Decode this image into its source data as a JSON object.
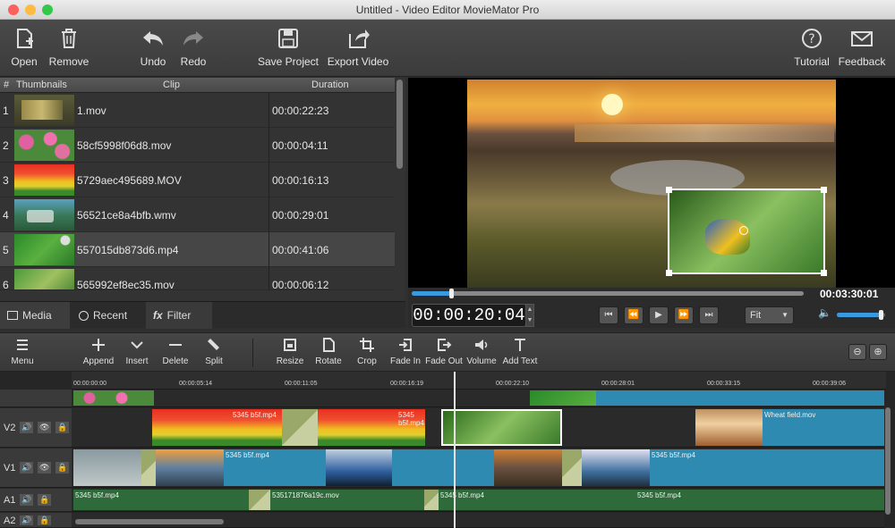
{
  "window": {
    "title": "Untitled - Video Editor MovieMator Pro"
  },
  "toolbar": {
    "open": "Open",
    "remove": "Remove",
    "undo": "Undo",
    "redo": "Redo",
    "save_project": "Save Project",
    "export_video": "Export Video",
    "tutorial": "Tutorial",
    "feedback": "Feedback"
  },
  "media_table": {
    "headers": {
      "num": "#",
      "thumbnails": "Thumbnails",
      "clip": "Clip",
      "duration": "Duration"
    },
    "rows": [
      {
        "num": "1",
        "clip": "1.mov",
        "duration": "00:00:22:23"
      },
      {
        "num": "2",
        "clip": "58cf5998f06d8.mov",
        "duration": "00:00:04:11"
      },
      {
        "num": "3",
        "clip": "5729aec495689.MOV",
        "duration": "00:00:16:13"
      },
      {
        "num": "4",
        "clip": "56521ce8a4bfb.wmv",
        "duration": "00:00:29:01"
      },
      {
        "num": "5",
        "clip": "557015db873d6.mp4",
        "duration": "00:00:41:06"
      },
      {
        "num": "6",
        "clip": "565992ef8ec35.mov",
        "duration": "00:00:06:12"
      }
    ]
  },
  "media_tabs": {
    "media": "Media",
    "recent": "Recent",
    "filter": "Filter"
  },
  "preview": {
    "total_time": "00:03:30:01",
    "current_timecode": "00:00:20:04",
    "fit_label": "Fit",
    "progress": 0.1,
    "volume": 0.9
  },
  "edit_toolbar": {
    "menu": "Menu",
    "append": "Append",
    "insert": "Insert",
    "delete": "Delete",
    "split": "Split",
    "resize": "Resize",
    "rotate": "Rotate",
    "crop": "Crop",
    "fade_in": "Fade In",
    "fade_out": "Fade Out",
    "volume": "Volume",
    "add_text": "Add Text"
  },
  "timeline": {
    "ruler": [
      "00:00:00:00",
      "00:00:05:14",
      "00:00:11:05",
      "00:00:16:19",
      "00:00:22:10",
      "00:00:28:01",
      "00:00:33:15",
      "00:00:39:06"
    ],
    "tracks": {
      "v2": "V2",
      "v1": "V1",
      "a1": "A1",
      "a2": "A2"
    },
    "clips": {
      "v2_a": "5345 b5f.mp4",
      "v2_b": "5345 b5f.mp4",
      "v2_wheat": "Wheat field.mov",
      "v1_a": "5345 b5f.mp4",
      "v1_b": "5345 b5f.mp4",
      "v1_c": "5345 b5f.mp4",
      "a1_a": "5345 b5f.mp4",
      "a1_b": "535171876a19c.mov",
      "a1_c": "5345 b5f.mp4",
      "a1_d": "5345 b5f.mp4"
    }
  }
}
